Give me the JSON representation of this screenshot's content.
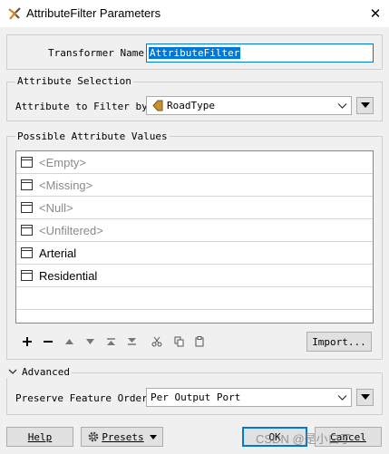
{
  "window": {
    "title": "AttributeFilter Parameters",
    "close_glyph": "✕"
  },
  "transformer": {
    "name_label": "Transformer Name:",
    "name_value": "AttributeFilter"
  },
  "attribute_selection": {
    "group_label": "Attribute Selection",
    "filter_label": "Attribute to Filter by:",
    "filter_value": "RoadType",
    "attribute_icon": "attribute-tag-icon",
    "attribute_icon_color": "#c8902f"
  },
  "possible_values": {
    "group_label": "Possible Attribute Values",
    "items": [
      {
        "label": "<Empty>",
        "special": true
      },
      {
        "label": "<Missing>",
        "special": true
      },
      {
        "label": "<Null>",
        "special": true
      },
      {
        "label": "<Unfiltered>",
        "special": true
      },
      {
        "label": "Arterial",
        "special": false
      },
      {
        "label": "Residential",
        "special": false
      }
    ],
    "import_label": "Import...",
    "toolbar_icons": [
      "add-icon",
      "remove-icon",
      "move-up-icon",
      "move-down-icon",
      "move-top-icon",
      "move-bottom-icon",
      "cut-icon",
      "copy-icon",
      "paste-icon"
    ]
  },
  "advanced": {
    "group_label": "Advanced",
    "preserve_label": "Preserve Feature Order:",
    "preserve_value": "Per Output Port"
  },
  "footer": {
    "help_label": "Help",
    "presets_label": "Presets",
    "ok_label": "OK",
    "cancel_label": "Cancel"
  },
  "watermark": "CSDN @是小白了"
}
